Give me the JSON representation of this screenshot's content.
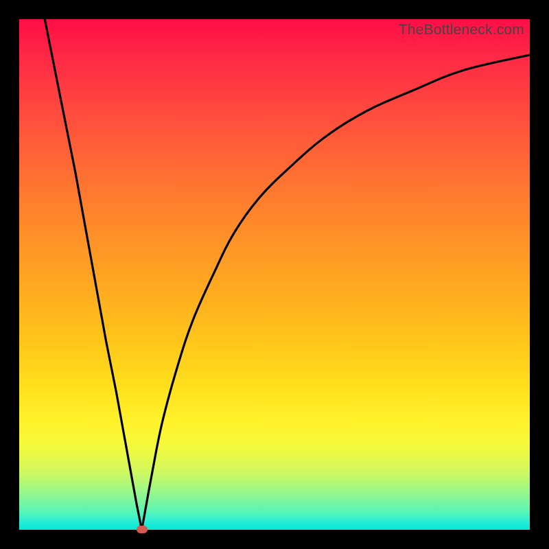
{
  "credit_text": "TheBottleneck.com",
  "colors": {
    "frame": "#000000",
    "curve": "#000000",
    "marker": "#d45a52"
  },
  "chart_data": {
    "type": "line",
    "title": "",
    "xlabel": "",
    "ylabel": "",
    "xlim": [
      0,
      100
    ],
    "ylim": [
      0,
      100
    ],
    "grid": false,
    "legend": false,
    "annotations": [
      "TheBottleneck.com"
    ],
    "marker": {
      "x": 24,
      "y": 0
    },
    "series": [
      {
        "name": "left-segment",
        "x": [
          5,
          7,
          9,
          11,
          13,
          15,
          17,
          19,
          21,
          23,
          24
        ],
        "values": [
          100,
          90,
          80,
          70,
          59,
          48,
          37,
          27,
          16,
          5,
          0
        ]
      },
      {
        "name": "right-segment",
        "x": [
          24,
          26,
          28,
          31,
          34,
          38,
          42,
          47,
          53,
          60,
          68,
          77,
          87,
          100
        ],
        "values": [
          0,
          11,
          21,
          32,
          41,
          50,
          58,
          65,
          71,
          77,
          82,
          86,
          90,
          93
        ]
      }
    ],
    "background_gradient": {
      "direction": "top-to-bottom",
      "stops": [
        {
          "pos": 0.0,
          "color": "#ff0d47"
        },
        {
          "pos": 0.18,
          "color": "#ff4a3e"
        },
        {
          "pos": 0.42,
          "color": "#ff8f28"
        },
        {
          "pos": 0.64,
          "color": "#ffc81a"
        },
        {
          "pos": 0.8,
          "color": "#fff22b"
        },
        {
          "pos": 0.9,
          "color": "#b6f872"
        },
        {
          "pos": 1.0,
          "color": "#09e8d0"
        }
      ]
    }
  }
}
